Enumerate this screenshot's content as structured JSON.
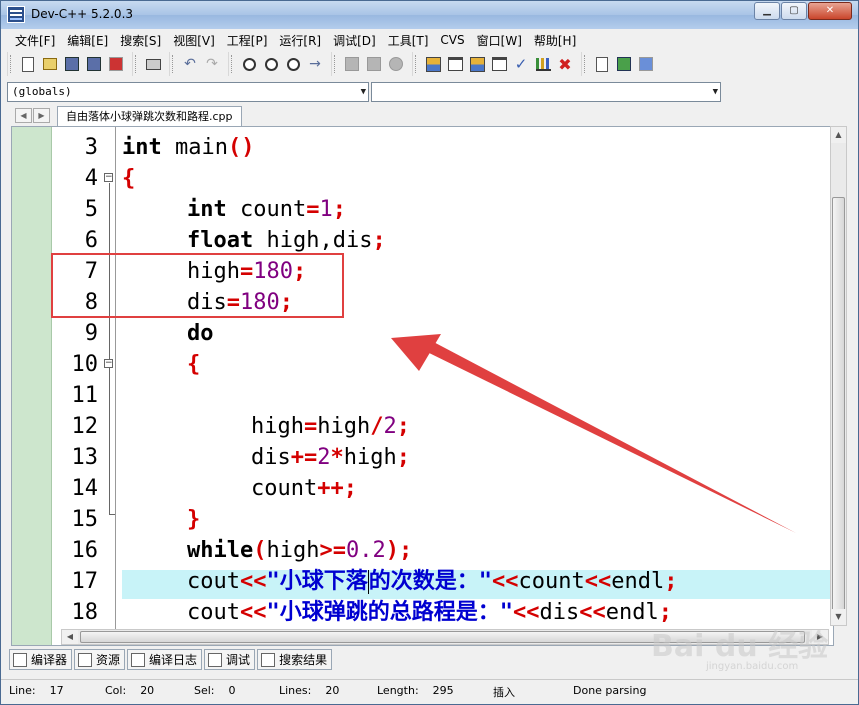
{
  "window": {
    "title": "Dev-C++ 5.2.0.3"
  },
  "menu": [
    "文件[F]",
    "编辑[E]",
    "搜索[S]",
    "视图[V]",
    "工程[P]",
    "运行[R]",
    "调试[D]",
    "工具[T]",
    "CVS",
    "窗口[W]",
    "帮助[H]"
  ],
  "combos": {
    "scope": "(globals)",
    "symbol": ""
  },
  "file_tab": "自由落体小球弹跳次数和路程.cpp",
  "code": {
    "line_numbers": [
      "3",
      "4",
      "5",
      "6",
      "7",
      "8",
      "9",
      "10",
      "11",
      "12",
      "13",
      "14",
      "15",
      "16",
      "17",
      "18"
    ],
    "l3": [
      "int",
      "main",
      "()"
    ],
    "l4": [
      "{"
    ],
    "l5": [
      "int",
      "count",
      "=",
      "1",
      ";"
    ],
    "l6": [
      "float",
      "high,dis",
      ";"
    ],
    "l7": [
      "high",
      "=",
      "180",
      ";"
    ],
    "l8": [
      "dis",
      "=",
      "180",
      ";"
    ],
    "l9": [
      "do"
    ],
    "l10": [
      "{"
    ],
    "l12": [
      "high",
      "=",
      "high",
      "/",
      "2",
      ";"
    ],
    "l13": [
      "dis",
      "+=",
      "2",
      "*",
      "high",
      ";"
    ],
    "l14": [
      "count",
      "++",
      ";"
    ],
    "l15": [
      "}"
    ],
    "l16": [
      "while",
      "(",
      "high",
      ">=",
      "0.2",
      ")",
      ";"
    ],
    "l17": [
      "cout",
      "<<",
      "\"小球下落",
      "的次数是：\"",
      "<<",
      "count",
      "<<",
      "endl",
      ";"
    ],
    "l18": [
      "cout",
      "<<",
      "\"小球弹跳的总路程是：\"",
      "<<",
      "dis",
      "<<",
      "endl",
      ";"
    ]
  },
  "bottom_tabs": [
    "编译器",
    "资源",
    "编译日志",
    "调试",
    "搜索结果"
  ],
  "status": {
    "line_label": "Line:",
    "line": "17",
    "col_label": "Col:",
    "col": "20",
    "sel_label": "Sel:",
    "sel": "0",
    "lines_label": "Lines:",
    "lines": "20",
    "length_label": "Length:",
    "length": "295",
    "mode": "插入",
    "message": "Done parsing"
  },
  "watermark": "Bai du 经验",
  "watermark_sub": "jingyan.baidu.com",
  "colors": {
    "keyword": "#000000",
    "operator": "#d40000",
    "number": "#800080",
    "string": "#0000d0",
    "highlight_line": "#c8f3f8",
    "annotation": "#e04040"
  }
}
